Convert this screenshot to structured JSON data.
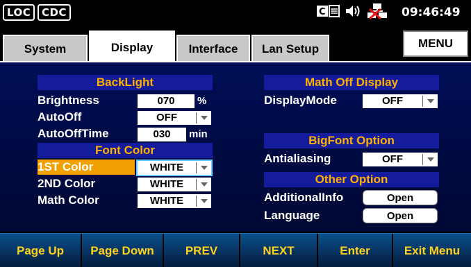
{
  "status_bar": {
    "loc_label": "LOC",
    "cdc_label": "CDC",
    "clock": "09:46:49",
    "icons": [
      "keyboard-icon",
      "speaker-icon",
      "network-disconnected-icon"
    ]
  },
  "tabs": [
    {
      "label": "System",
      "active": false
    },
    {
      "label": "Display",
      "active": true
    },
    {
      "label": "Interface",
      "active": false
    },
    {
      "label": "Lan Setup",
      "active": false
    }
  ],
  "menu_button": "MENU",
  "backlight": {
    "header": "BackLight",
    "brightness_label": "Brightness",
    "brightness_value": "070",
    "brightness_unit": "%",
    "autooff_label": "AutoOff",
    "autooff_value": "OFF",
    "autoofftime_label": "AutoOffTime",
    "autoofftime_value": "030",
    "autoofftime_unit": "min"
  },
  "font_color": {
    "header": "Font Color",
    "first_label": "1ST Color",
    "first_value": "WHITE",
    "second_label": "2ND Color",
    "second_value": "WHITE",
    "math_label": "Math Color",
    "math_value": "WHITE"
  },
  "math_off_display": {
    "header": "Math Off Display",
    "displaymode_label": "DisplayMode",
    "displaymode_value": "OFF"
  },
  "bigfont_option": {
    "header": "BigFont Option",
    "antialiasing_label": "Antialiasing",
    "antialiasing_value": "OFF"
  },
  "other_option": {
    "header": "Other Option",
    "additionalinfo_label": "AdditionalInfo",
    "additionalinfo_button": "Open",
    "language_label": "Language",
    "language_button": "Open"
  },
  "softkeys": [
    "Page Up",
    "Page Down",
    "PREV",
    "NEXT",
    "Enter",
    "Exit Menu"
  ],
  "colors": {
    "panel_bg": "#000e56",
    "header_bg": "#141c9c",
    "header_text": "#ffb000",
    "highlight": "#f0a000",
    "softkey_text": "#ffd21e"
  }
}
